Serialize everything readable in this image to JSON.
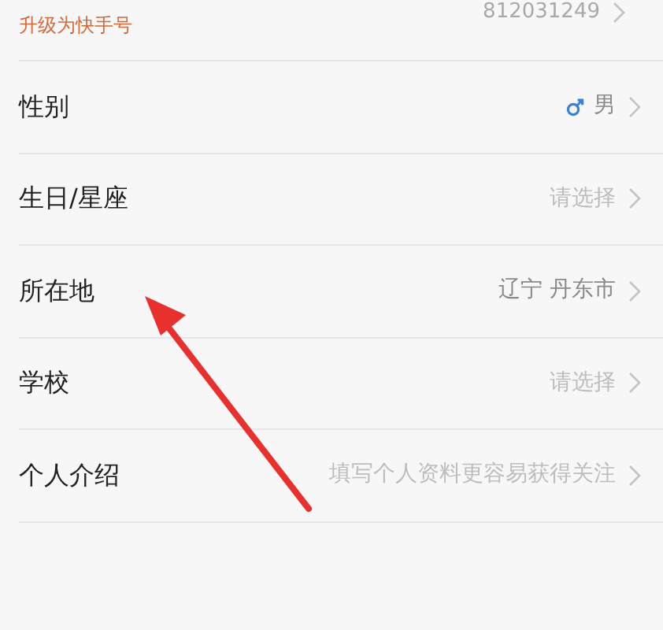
{
  "account": {
    "upgrade_link": "升级为快手号",
    "id": "812031249"
  },
  "rows": [
    {
      "label": "性别",
      "value": "男",
      "male_icon": true,
      "placeholder": false
    },
    {
      "label": "生日/星座",
      "value": "请选择",
      "placeholder": true
    },
    {
      "label": "所在地",
      "value": "辽宁 丹东市",
      "placeholder": false
    },
    {
      "label": "学校",
      "value": "请选择",
      "placeholder": true
    },
    {
      "label": "个人介绍",
      "value": "填写个人资料更容易获得关注",
      "placeholder": true
    }
  ]
}
